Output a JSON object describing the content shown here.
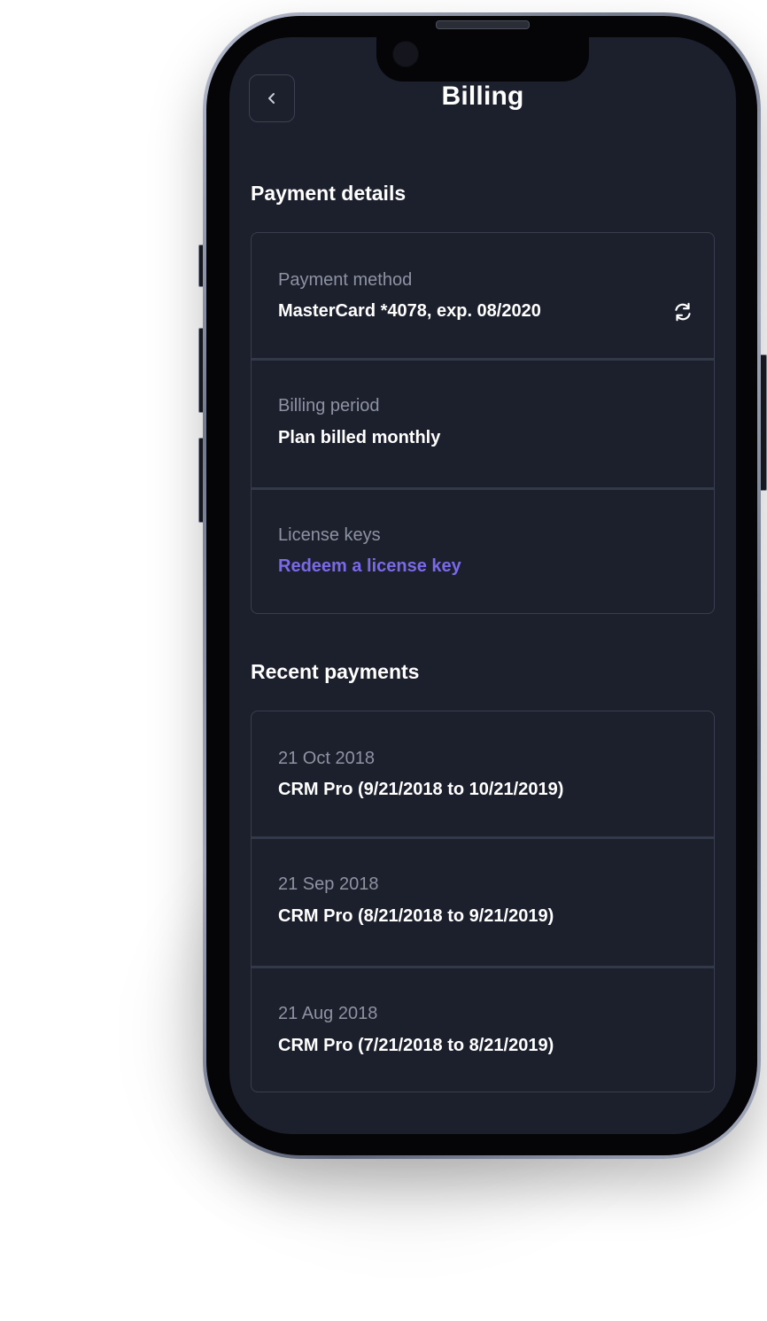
{
  "header": {
    "title": "Billing",
    "back_icon": "chevron-left-icon"
  },
  "payment_details": {
    "section_title": "Payment details",
    "rows": [
      {
        "label": "Payment method",
        "value": "MasterCard  *4078, exp. 08/2020",
        "action_icon": "refresh-icon"
      },
      {
        "label": "Billing period",
        "value": "Plan billed monthly"
      },
      {
        "label": "License keys",
        "value": "Redeem a license key"
      }
    ]
  },
  "recent_payments": {
    "section_title": "Recent payments",
    "rows": [
      {
        "date": "21 Oct 2018",
        "description": "CRM Pro (9/21/2018 to 10/21/2019)"
      },
      {
        "date": "21 Sep 2018",
        "description": "CRM Pro (8/21/2018 to 9/21/2019)"
      },
      {
        "date": "21 Aug 2018",
        "description": "CRM Pro (7/21/2018 to 8/21/2019)"
      }
    ]
  },
  "colors": {
    "screen_background": "#1c1f2c",
    "card_border": "#393e4f",
    "label_text": "#8e93a3",
    "value_text": "#ffffff",
    "link_accent": "#7b6ae8"
  }
}
